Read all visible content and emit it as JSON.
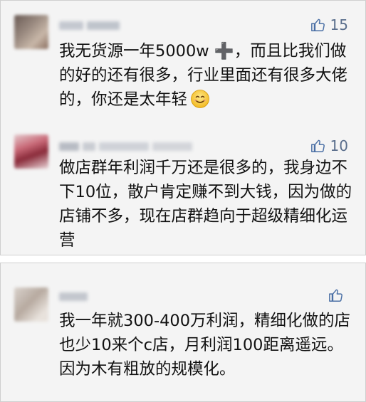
{
  "comments": [
    {
      "like_count": "15",
      "text": "我无货源一年5000w ➕，而且比我们做的好的还有很多，行业里面还有很多大佬的，你还是太年轻",
      "emoji": "smiling-face-emoji"
    },
    {
      "like_count": "10",
      "text": "做店群年利润千万还是很多的，我身边不下10位，散户肯定赚不到大钱，因为做的店铺不多，现在店群趋向于超级精细化运营"
    },
    {
      "like_count": "",
      "text": "我一年就300-400万利润，精细化做的店也少10来个c店，月利润100距离遥远。因为木有粗放的规模化。"
    }
  ],
  "colors": {
    "like_icon": "#4a6fa5",
    "panel_bg": "#f4f4f4",
    "text": "#111111"
  },
  "icons": {
    "like": "thumbs-up-icon"
  }
}
